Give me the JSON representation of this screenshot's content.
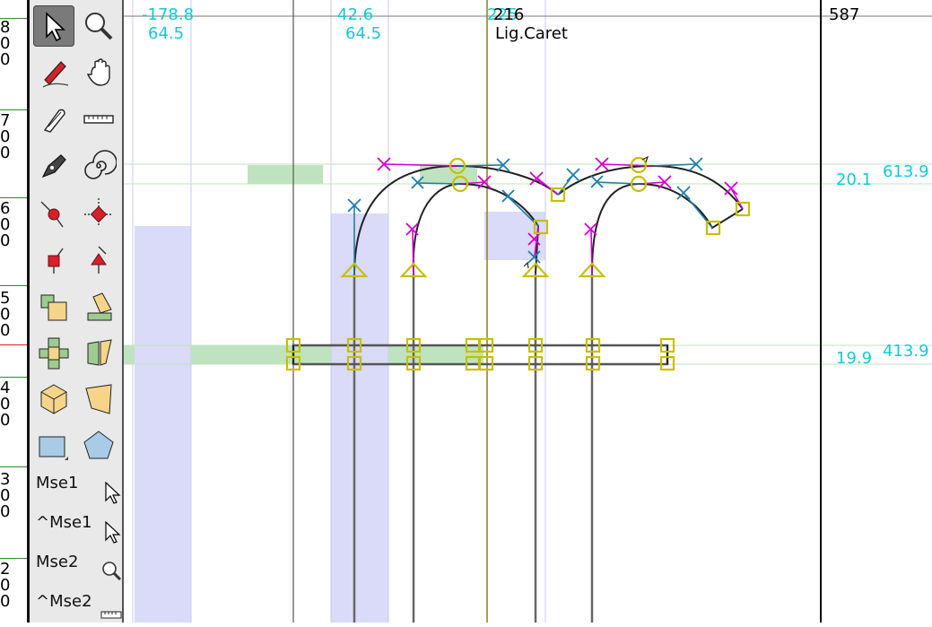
{
  "ruler": {
    "labels": [
      "8",
      "0",
      "0",
      "7",
      "0",
      "0",
      "6",
      "0",
      "0",
      "5",
      "0",
      "0",
      "4",
      "0",
      "0",
      "3",
      "0",
      "0",
      "2",
      "0",
      "0"
    ]
  },
  "toolbox": {
    "tools": [
      {
        "name": "pointer-tool",
        "selected": true
      },
      {
        "name": "magnify-tool"
      },
      {
        "name": "freehand-pencil-tool"
      },
      {
        "name": "scroll-hand-tool"
      },
      {
        "name": "knife-tool"
      },
      {
        "name": "ruler-tool"
      },
      {
        "name": "pen-tool"
      },
      {
        "name": "spiro-tool"
      },
      {
        "name": "curve-point-tool"
      },
      {
        "name": "corner-point-tool"
      },
      {
        "name": "tangent-point-tool"
      },
      {
        "name": "hv-curve-point-tool"
      },
      {
        "name": "scale-tool"
      },
      {
        "name": "skew-tool"
      },
      {
        "name": "rotate-tool"
      },
      {
        "name": "perspective-tool"
      },
      {
        "name": "3d-rotate-tool"
      },
      {
        "name": "transform-tool"
      },
      {
        "name": "rectangle-tool"
      },
      {
        "name": "polygon-tool"
      }
    ],
    "mouse_labels": {
      "mse1": "Mse1",
      "ctrl_mse1": "^Mse1",
      "mse2": "Mse2",
      "ctrl_mse2": "^Mse2"
    }
  },
  "canvas": {
    "coord_left_x": "-178.8",
    "coord_left_y": "64.5",
    "coord_mid_x": "42.6",
    "coord_mid_y": "64.5",
    "caret_value": "216",
    "caret_overlap": "225",
    "caret_label": "Lig.Caret",
    "advance_width": "587",
    "hint_upper_width": "20.1",
    "hint_upper_pos": "613.9",
    "hint_lower_width": "19.9",
    "hint_lower_pos": "413.9"
  },
  "colors": {
    "hint_green": "#bfe3bf",
    "hint_blue": "#d9dbf8",
    "cyan_text": "#12c9d6",
    "control_yellow": "#c5c000",
    "offcurve_magenta": "#d400d4",
    "offcurve_teal": "#1e7ea8"
  }
}
